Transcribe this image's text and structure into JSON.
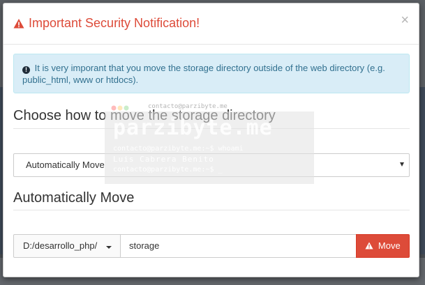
{
  "modal": {
    "title": "Important Security Notification!",
    "close_label": "×",
    "title_color": "#dd4b39"
  },
  "alert": {
    "icon": "info-circle-icon",
    "text": "It is very imporant that you move the storage directory outside of the web directory (e.g. public_html, www or htdocs)."
  },
  "choose_section": {
    "title": "Choose how to move the storage directory",
    "select_value": "Automatically Move"
  },
  "auto_section": {
    "title": "Automatically Move",
    "directory_label": "D:/desarrollo_php/",
    "input_value": "storage",
    "move_button_label": "Move",
    "move_button_color": "#dd4b39"
  },
  "watermark": {
    "line_top": "contacto@parzibyte.me",
    "logo": "parzibyte.me",
    "line_1": "contacto@parzibyte.me:~$ whoami",
    "line_2": "Luis Cabrera Benito",
    "line_3": "contacto@parzibyte.me:~$ _"
  }
}
